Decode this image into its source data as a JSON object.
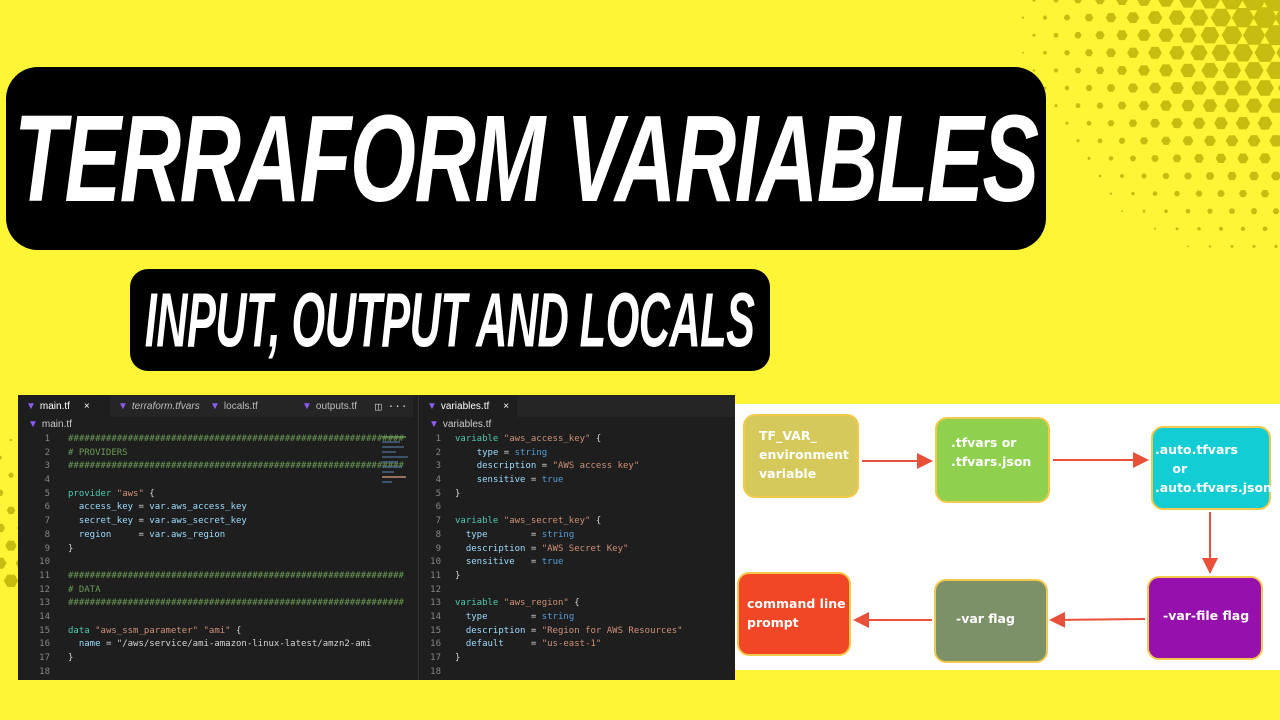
{
  "title": "TERRAFORM VARIABLES",
  "subtitle": "INPUT, OUTPUT AND LOCALS",
  "colors": {
    "background": "#fdf535",
    "hex_pattern": "#c7bd10",
    "banner": "#000000",
    "editor_bg": "#1e1e1e",
    "arrow": "#e8503a"
  },
  "editor": {
    "left_tabs": [
      {
        "label": "main.tf",
        "active": true,
        "icon": "terraform-icon",
        "close": "×"
      },
      {
        "label": "terraform.tfvars",
        "italic": true,
        "icon": "terraform-icon"
      },
      {
        "label": "locals.tf",
        "icon": "terraform-icon"
      },
      {
        "label": "outputs.tf",
        "icon": "terraform-icon"
      }
    ],
    "split_icon": "◫",
    "more_icon": "···",
    "right_tabs": [
      {
        "label": "variables.tf",
        "active": true,
        "icon": "terraform-icon",
        "close": "×"
      }
    ],
    "left_breadcrumb": "main.tf",
    "right_breadcrumb": "variables.tf",
    "left_code": [
      {
        "n": "1",
        "t": "##############################################################",
        "k": "com"
      },
      {
        "n": "2",
        "t": "# PROVIDERS",
        "k": "com"
      },
      {
        "n": "3",
        "t": "##############################################################",
        "k": "com"
      },
      {
        "n": "4",
        "t": "",
        "k": "op"
      },
      {
        "n": "5",
        "t": "provider \"aws\" {",
        "k": "kw"
      },
      {
        "n": "6",
        "t": "  access_key = var.aws_access_key",
        "k": "attr"
      },
      {
        "n": "7",
        "t": "  secret_key = var.aws_secret_key",
        "k": "attr"
      },
      {
        "n": "8",
        "t": "  region     = var.aws_region",
        "k": "attr"
      },
      {
        "n": "9",
        "t": "}",
        "k": "op"
      },
      {
        "n": "10",
        "t": "",
        "k": "op"
      },
      {
        "n": "11",
        "t": "##############################################################",
        "k": "com"
      },
      {
        "n": "12",
        "t": "# DATA",
        "k": "com"
      },
      {
        "n": "13",
        "t": "##############################################################",
        "k": "com"
      },
      {
        "n": "14",
        "t": "",
        "k": "op"
      },
      {
        "n": "15",
        "t": "data \"aws_ssm_parameter\" \"ami\" {",
        "k": "kw"
      },
      {
        "n": "16",
        "t": "  name = \"/aws/service/ami-amazon-linux-latest/amzn2-ami",
        "k": "str"
      },
      {
        "n": "17",
        "t": "}",
        "k": "op"
      },
      {
        "n": "18",
        "t": "",
        "k": "op"
      }
    ],
    "right_code": [
      {
        "n": "1",
        "t": "variable \"aws_access_key\" {",
        "k": "kw"
      },
      {
        "n": "2",
        "t": "    type = string",
        "k": "attr"
      },
      {
        "n": "3",
        "t": "    description = \"AWS access key\"",
        "k": "str"
      },
      {
        "n": "4",
        "t": "    sensitive = true",
        "k": "attr"
      },
      {
        "n": "5",
        "t": "}",
        "k": "op"
      },
      {
        "n": "6",
        "t": "",
        "k": "op"
      },
      {
        "n": "7",
        "t": "variable \"aws_secret_key\" {",
        "k": "kw"
      },
      {
        "n": "8",
        "t": "  type        = string",
        "k": "attr"
      },
      {
        "n": "9",
        "t": "  description = \"AWS Secret Key\"",
        "k": "str"
      },
      {
        "n": "10",
        "t": "  sensitive   = true",
        "k": "attr"
      },
      {
        "n": "11",
        "t": "}",
        "k": "op"
      },
      {
        "n": "12",
        "t": "",
        "k": "op"
      },
      {
        "n": "13",
        "t": "variable \"aws_region\" {",
        "k": "kw"
      },
      {
        "n": "14",
        "t": "  type        = string",
        "k": "attr"
      },
      {
        "n": "15",
        "t": "  description = \"Region for AWS Resources\"",
        "k": "str"
      },
      {
        "n": "16",
        "t": "  default     = \"us-east-1\"",
        "k": "str"
      },
      {
        "n": "17",
        "t": "}",
        "k": "op"
      },
      {
        "n": "18",
        "t": "",
        "k": "op"
      }
    ]
  },
  "flow": {
    "nodes": [
      {
        "id": "tf-var-env",
        "label": "TF_VAR_\nenvironment\nvariable",
        "color": "#d4c95a"
      },
      {
        "id": "tfvars",
        "label": ".tfvars or\n.tfvars.json",
        "color": "#8fd14f"
      },
      {
        "id": "auto-tfvars",
        "label": ".auto.tfvars\n    or\n.auto.tfvars.json",
        "color": "#12cdd4"
      },
      {
        "id": "var-file-flag",
        "label": "-var-file flag",
        "color": "#9510ac"
      },
      {
        "id": "var-flag",
        "label": "-var flag",
        "color": "#7d9169"
      },
      {
        "id": "command-line-prompt",
        "label": "command line\nprompt",
        "color": "#f24726"
      }
    ]
  }
}
